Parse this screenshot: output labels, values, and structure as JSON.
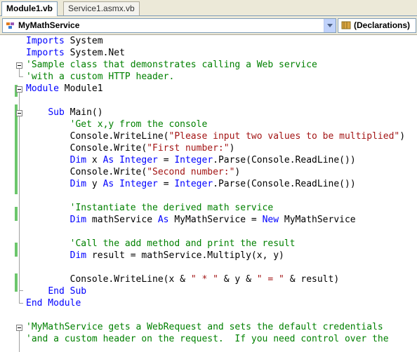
{
  "tabs": [
    {
      "label": "Module1.vb",
      "active": true
    },
    {
      "label": "Service1.asmx.vb",
      "active": false
    }
  ],
  "dropdowns": {
    "class_name": "MyMathService",
    "method_name": "(Declarations)"
  },
  "code": {
    "l1": [
      "Imports",
      " System"
    ],
    "l2": [
      "Imports",
      " System.Net"
    ],
    "l3": "'Sample class that demonstrates calling a Web service",
    "l4": "'with a custom HTTP header.",
    "l5": [
      "Module",
      " Module1"
    ],
    "l7": [
      "    ",
      "Sub",
      " Main()"
    ],
    "l8": "        'Get x,y from the console",
    "l9": [
      "        Console.WriteLine(",
      "\"Please input two values to be multiplied\"",
      ")"
    ],
    "l10": [
      "        Console.Write(",
      "\"First number:\"",
      ")"
    ],
    "l11": [
      "        ",
      "Dim",
      " x ",
      "As",
      " ",
      "Integer",
      " = ",
      "Integer",
      ".Parse(Console.ReadLine())"
    ],
    "l12": [
      "        Console.Write(",
      "\"Second number:\"",
      ")"
    ],
    "l13": [
      "        ",
      "Dim",
      " y ",
      "As",
      " ",
      "Integer",
      " = ",
      "Integer",
      ".Parse(Console.ReadLine())"
    ],
    "l15": "        'Instantiate the derived math service",
    "l16": [
      "        ",
      "Dim",
      " mathService ",
      "As",
      " MyMathService = ",
      "New",
      " MyMathService"
    ],
    "l18": "        'Call the add method and print the result",
    "l19": [
      "        ",
      "Dim",
      " result = mathService.Multiply(x, y)"
    ],
    "l21": [
      "        Console.WriteLine(x & ",
      "\" * \"",
      " & y & ",
      "\" = \"",
      " & result)"
    ],
    "l22": [
      "    ",
      "End Sub"
    ],
    "l23": [
      "End Module"
    ],
    "l25": "'MyMathService gets a WebRequest and sets the default credentials",
    "l26": "'and a custom header on the request.  If you need control over the"
  }
}
